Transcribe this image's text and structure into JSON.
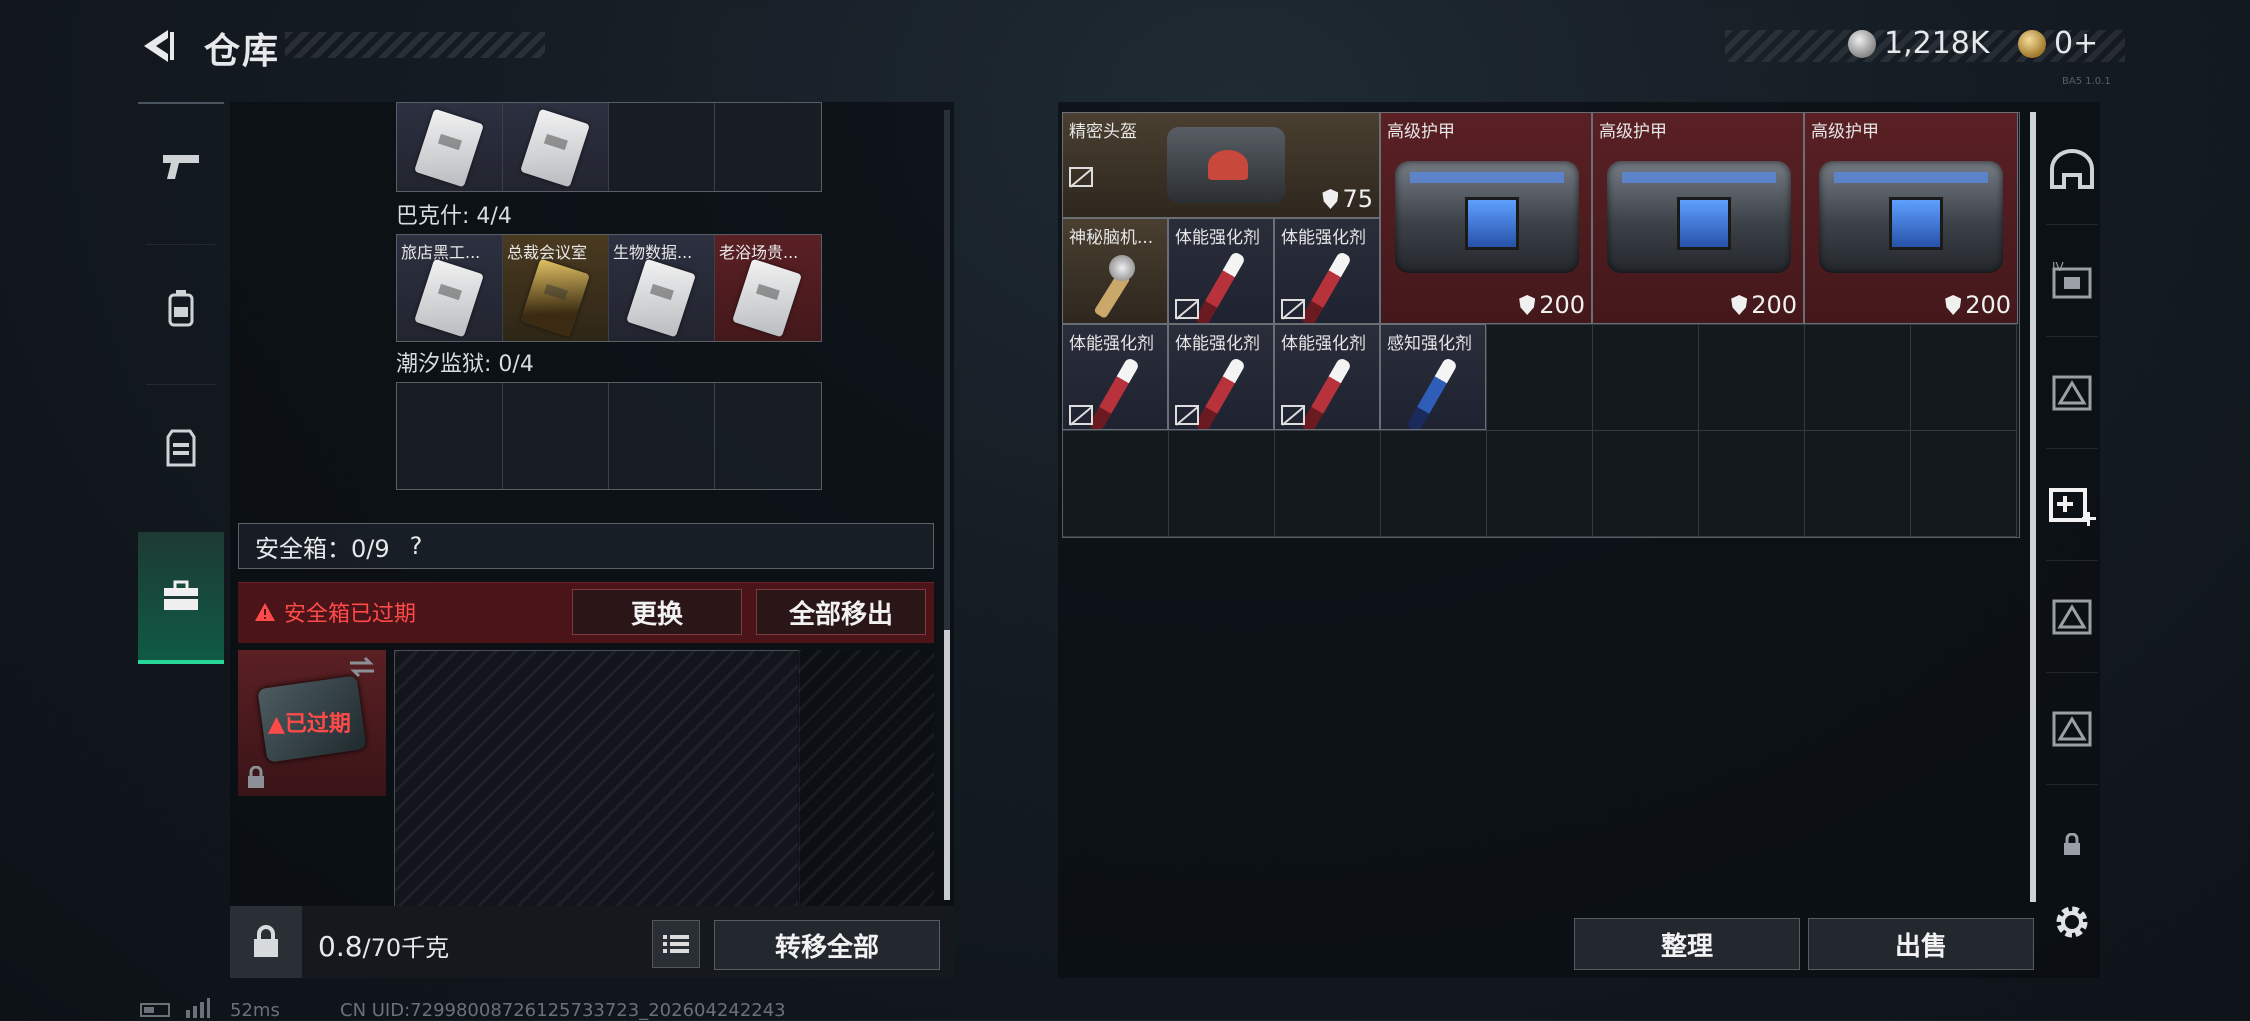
{
  "header": {
    "title": "仓库",
    "currency_silver": "1,218K",
    "currency_gold": "0+",
    "tiny_code": "BA5 1.0.1"
  },
  "backpack": {
    "sections": [
      {
        "label": "巴克什: 4/4",
        "cells": [
          "旅店黑工...",
          "总裁会议室",
          "生物数据...",
          "老浴场贵..."
        ]
      },
      {
        "label": "潮汐监狱: 0/4"
      }
    ],
    "safe_box": {
      "label": "安全箱：0/9",
      "help": "?",
      "warning": "安全箱已过期",
      "replace_button": "更换",
      "move_all_out_button": "全部移出",
      "expired": "已过期"
    },
    "weight_value": "0.8",
    "weight_max": "/70千克",
    "transfer_all_button": "转移全部"
  },
  "storage": {
    "items": [
      {
        "name": "精密头盔",
        "durability": "75",
        "kind": "helmet"
      },
      {
        "name": "高级护甲",
        "durability": "200",
        "kind": "armor"
      },
      {
        "name": "高级护甲",
        "durability": "200",
        "kind": "armor"
      },
      {
        "name": "高级护甲",
        "durability": "200",
        "kind": "armor"
      },
      {
        "name": "神秘脑机...",
        "kind": "watch"
      },
      {
        "name": "体能强化剂",
        "kind": "syringe"
      },
      {
        "name": "体能强化剂",
        "kind": "syringe"
      },
      {
        "name": "体能强化剂",
        "kind": "syringe"
      },
      {
        "name": "体能强化剂",
        "kind": "syringe"
      },
      {
        "name": "体能强化剂",
        "kind": "syringe"
      },
      {
        "name": "感知强化剂",
        "kind": "syringe-blue"
      }
    ],
    "sort_button": "整理",
    "sell_button": "出售"
  },
  "status_bar": {
    "ping": "52ms",
    "uid": "CN UID:72998008726125733723_202604242243"
  },
  "colors": {
    "accent_green": "#29d69a",
    "warning_red": "#ff4a4a",
    "item_red_bg": "#5a2024"
  },
  "icons": {
    "nav": [
      "pistol-icon",
      "backpack-icon",
      "vest-icon",
      "toolbox-icon"
    ],
    "rail": [
      "helmet-slot-icon",
      "armor-slot-icon",
      "rig-slot-icon",
      "medkit-slot-icon",
      "case-slot-icon",
      "case-slot-icon",
      "lock-icon",
      "gear-icon"
    ]
  }
}
